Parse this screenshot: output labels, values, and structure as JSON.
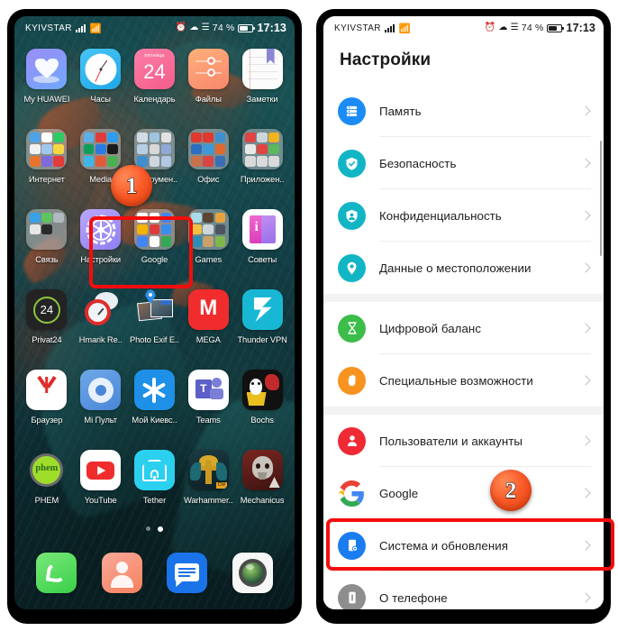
{
  "statusbar": {
    "carrier": "KYIVSTAR",
    "signal_icon": "signal-bars-icon",
    "wifi_icon": "wifi-icon",
    "alarm_icon": "alarm-clock-icon",
    "bluetooth_icon": "bluetooth-icon",
    "vibrate_icon": "vibrate-icon",
    "battery_percent": "74 %",
    "battery_icon": "battery-icon",
    "time": "17:13"
  },
  "home_screen": {
    "rows": [
      [
        {
          "label": "My HUAWEI",
          "icon": "my-huawei-icon"
        },
        {
          "label": "Часы",
          "icon": "clock-icon"
        },
        {
          "label": "Календарь",
          "icon": "calendar-icon",
          "badge_top": "пятница",
          "day": "24"
        },
        {
          "label": "Файлы",
          "icon": "files-icon"
        },
        {
          "label": "Заметки",
          "icon": "notes-icon"
        }
      ],
      [
        {
          "label": "Интернет",
          "icon": "folder-icon"
        },
        {
          "label": "Media",
          "icon": "folder-icon"
        },
        {
          "label": "Инструмен..",
          "icon": "folder-icon"
        },
        {
          "label": "Офис",
          "icon": "folder-icon"
        },
        {
          "label": "Приложен..",
          "icon": "folder-icon"
        }
      ],
      [
        {
          "label": "Связь",
          "icon": "folder-icon"
        },
        {
          "label": "Настройки",
          "icon": "settings-gear-icon"
        },
        {
          "label": "Google",
          "icon": "folder-icon"
        },
        {
          "label": "Games",
          "icon": "folder-icon"
        },
        {
          "label": "Советы",
          "icon": "tips-icon"
        }
      ],
      [
        {
          "label": "Privat24",
          "icon": "privat24-icon"
        },
        {
          "label": "Hmarik Re..",
          "icon": "hmarik-alarm-icon"
        },
        {
          "label": "Photo Exif E..",
          "icon": "photo-exif-icon"
        },
        {
          "label": "MEGA",
          "icon": "mega-icon"
        },
        {
          "label": "Thunder VPN",
          "icon": "thunder-vpn-icon"
        }
      ],
      [
        {
          "label": "Браузер",
          "icon": "yandex-browser-icon"
        },
        {
          "label": "Mi Пульт",
          "icon": "mi-remote-icon"
        },
        {
          "label": "Мой Киевс..",
          "icon": "my-kyivstar-icon"
        },
        {
          "label": "Teams",
          "icon": "teams-icon"
        },
        {
          "label": "Bochs",
          "icon": "bochs-icon"
        }
      ],
      [
        {
          "label": "PHEM",
          "icon": "phem-icon"
        },
        {
          "label": "YouTube",
          "icon": "youtube-icon"
        },
        {
          "label": "Tether",
          "icon": "tether-icon"
        },
        {
          "label": "Warhammer..",
          "icon": "warhammer-icon"
        },
        {
          "label": "Mechanicus",
          "icon": "mechanicus-icon"
        }
      ]
    ],
    "dock": [
      {
        "label": "",
        "icon": "phone-icon"
      },
      {
        "label": "",
        "icon": "contacts-icon"
      },
      {
        "label": "",
        "icon": "messages-icon"
      },
      {
        "label": "",
        "icon": "camera-icon"
      }
    ],
    "page_dots": {
      "count": 2,
      "active_index": 1
    }
  },
  "settings": {
    "title": "Настройки",
    "groups": [
      {
        "items": [
          {
            "label": "Память",
            "icon": "storage-icon",
            "color": "#1b8cf5"
          },
          {
            "label": "Безопасность",
            "icon": "shield-check-icon",
            "color": "#12b5c4"
          },
          {
            "label": "Конфиденциальность",
            "icon": "privacy-badge-icon",
            "color": "#12b5c4"
          },
          {
            "label": "Данные о местоположении",
            "icon": "location-pin-icon",
            "color": "#12b5c4"
          }
        ]
      },
      {
        "items": [
          {
            "label": "Цифровой баланс",
            "icon": "hourglass-icon",
            "color": "#3cbd4a"
          },
          {
            "label": "Специальные возможности",
            "icon": "hand-icon",
            "color": "#f7931e"
          }
        ]
      },
      {
        "items": [
          {
            "label": "Пользователи и аккаунты",
            "icon": "user-icon",
            "color": "#f02a35"
          },
          {
            "label": "Google",
            "icon": "google-g-icon",
            "color": "#ffffff"
          },
          {
            "label": "Система и обновления",
            "icon": "system-update-icon",
            "color": "#1b7cf0",
            "highlighted": true
          },
          {
            "label": "О телефоне",
            "icon": "phone-info-icon",
            "color": "#8e8e8e"
          }
        ]
      }
    ]
  },
  "annotations": {
    "highlight_color": "#f40c0c",
    "badges": [
      {
        "number": "1",
        "target": "settings-app-icon-home"
      },
      {
        "number": "2",
        "target": "system-and-updates-row"
      }
    ]
  }
}
